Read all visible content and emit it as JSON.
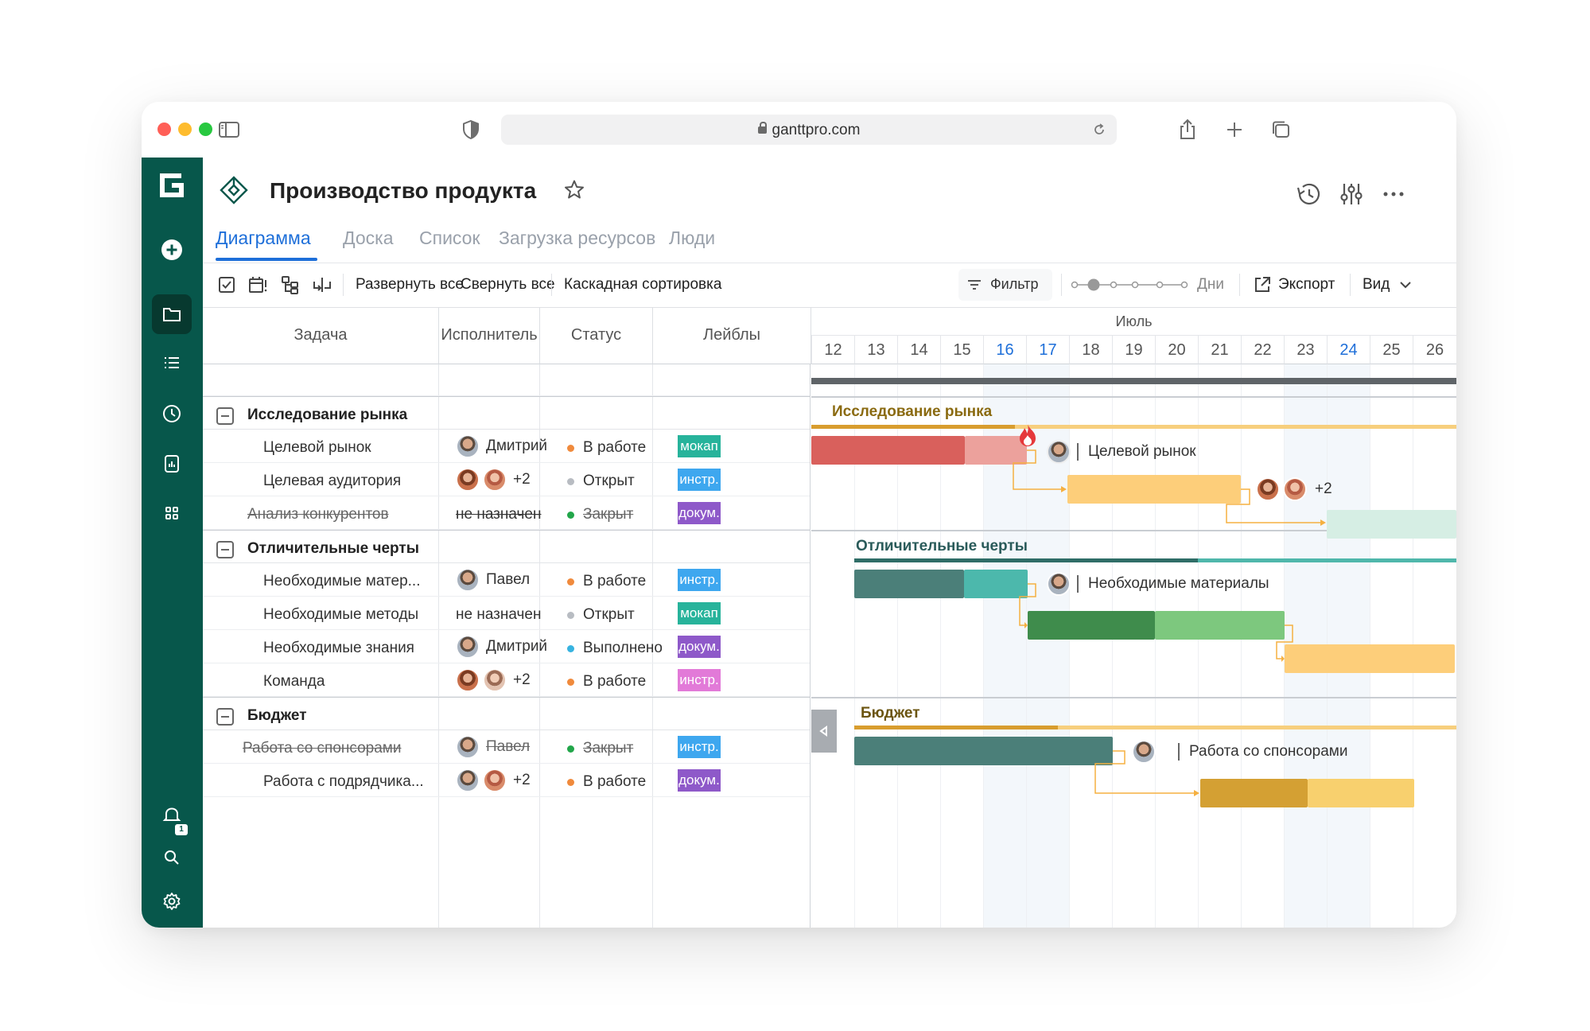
{
  "browser": {
    "url": "ganttpro.com"
  },
  "project": {
    "title": "Производство продукта"
  },
  "tabs": [
    {
      "label": "Диаграмма",
      "active": true
    },
    {
      "label": "Доска",
      "active": false
    },
    {
      "label": "Список",
      "active": false
    },
    {
      "label": "Загрузка ресурсов",
      "active": false
    },
    {
      "label": "Люди",
      "active": false
    }
  ],
  "toolbar": {
    "expand_all": "Развернуть все",
    "collapse_all": "Свернуть все",
    "cascade_sort": "Каскадная сортировка",
    "filter": "Фильтр",
    "zoom_label": "Дни",
    "export": "Экспорт",
    "view": "Вид"
  },
  "sidebar": {
    "notification_count": "1"
  },
  "columns": {
    "task": "Задача",
    "assignee": "Исполнитель",
    "status": "Статус",
    "labels": "Лейблы"
  },
  "timeline": {
    "month": "Июль",
    "days": [
      "12",
      "13",
      "14",
      "15",
      "16",
      "17",
      "18",
      "19",
      "20",
      "21",
      "22",
      "23",
      "24",
      "25",
      "26"
    ]
  },
  "groups": [
    {
      "name": "Исследование рынка",
      "tasks": [
        {
          "name": "Целевой рынок",
          "assignee": "Дмитрий",
          "avatars": [
            "male"
          ],
          "status": "В работе",
          "status_color": "#f08a3c",
          "label": "мокап",
          "label_color": "#27b39b",
          "done": false
        },
        {
          "name": "Целевая аудитория",
          "assignee": "+2",
          "avatars": [
            "female",
            "female2"
          ],
          "status": "Открыт",
          "status_color": "#b8bcc2",
          "label": "инстр.",
          "label_color": "#3ea7ef",
          "done": false
        },
        {
          "name": "Анализ конкурентов",
          "assignee": "не назначен",
          "avatars": [],
          "status": "Закрыт",
          "status_color": "#22a64a",
          "label": "докум.",
          "label_color": "#8e59c9",
          "done": true
        }
      ]
    },
    {
      "name": "Отличительные черты",
      "tasks": [
        {
          "name": "Необходимые матер...",
          "assignee": "Павел",
          "avatars": [
            "male"
          ],
          "status": "В работе",
          "status_color": "#f08a3c",
          "label": "инстр.",
          "label_color": "#3ea7ef",
          "done": false
        },
        {
          "name": "Необходимые методы",
          "assignee": "не назначен",
          "avatars": [],
          "status": "Открыт",
          "status_color": "#b8bcc2",
          "label": "мокап",
          "label_color": "#27b39b",
          "done": false
        },
        {
          "name": "Необходимые знания",
          "assignee": "Дмитрий",
          "avatars": [
            "male"
          ],
          "status": "Выполнено",
          "status_color": "#37b3e0",
          "label": "докум.",
          "label_color": "#8e59c9",
          "done": false
        },
        {
          "name": "Команда",
          "assignee": "+2",
          "avatars": [
            "female",
            "female3"
          ],
          "status": "В работе",
          "status_color": "#f08a3c",
          "label": "инстр.",
          "label_color": "#e27ad8",
          "done": false
        }
      ]
    },
    {
      "name": "Бюджет",
      "tasks": [
        {
          "name": "Работа со спонсорами",
          "assignee": "Павел",
          "avatars": [
            "male"
          ],
          "status": "Закрыт",
          "status_color": "#22a64a",
          "label": "инстр.",
          "label_color": "#3ea7ef",
          "done": true
        },
        {
          "name": "Работа с подрядчика...",
          "assignee": "+2",
          "avatars": [
            "male",
            "female2"
          ],
          "status": "В работе",
          "status_color": "#f08a3c",
          "label": "докум.",
          "label_color": "#8e59c9",
          "done": false
        }
      ]
    }
  ],
  "gantt_labels": {
    "group1": "Исследование рынка",
    "group2": "Отличительные черты",
    "group3": "Бюджет",
    "task1": "Целевой рынок",
    "task1_2": "+2",
    "task2": "Необходимые материалы",
    "task3": "Работа со спонсорами"
  },
  "colors": {
    "sidebar": "#07574b",
    "accent": "#1e6fd9"
  }
}
